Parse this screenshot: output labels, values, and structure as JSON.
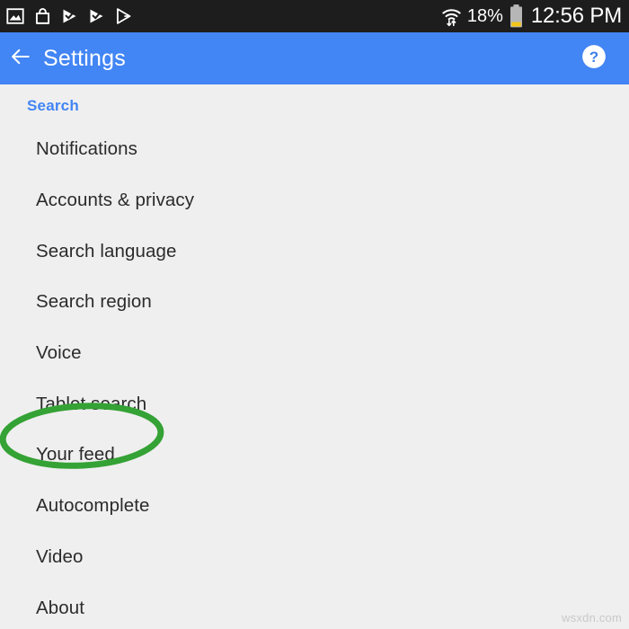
{
  "status_bar": {
    "background_color": "#1d1d1d",
    "left_icons": [
      {
        "name": "screenshot-icon",
        "label": "Screenshot"
      },
      {
        "name": "shopping-bag-icon",
        "label": "Shopping bag"
      },
      {
        "name": "play-check-icon-1",
        "label": "Play update"
      },
      {
        "name": "play-check-icon-2",
        "label": "Play update"
      },
      {
        "name": "play-store-icon",
        "label": "Play Store"
      }
    ],
    "wifi_icon": "wifi-transfer-icon",
    "battery_percent": "18%",
    "battery_icon": "battery-low-icon",
    "battery_fill_color": "#f5c518",
    "clock": "12:56 PM"
  },
  "app_bar": {
    "background_color": "#4285f4",
    "back_icon": "back-arrow-icon",
    "title": "Settings",
    "help_icon": "help-circle-icon"
  },
  "content": {
    "section_header": "Search",
    "section_header_color": "#4285f4",
    "background_color": "#efefef",
    "items": [
      {
        "label": "Notifications"
      },
      {
        "label": "Accounts & privacy"
      },
      {
        "label": "Search language"
      },
      {
        "label": "Search region"
      },
      {
        "label": "Voice"
      },
      {
        "label": "Tablet search"
      },
      {
        "label": "Your feed"
      },
      {
        "label": "Autocomplete"
      },
      {
        "label": "Video"
      },
      {
        "label": "About"
      }
    ]
  },
  "annotation": {
    "type": "ellipse-highlight",
    "target": "Voice",
    "color": "#34a234",
    "stroke_width": 7
  },
  "watermark": {
    "text": "wsxdn.com",
    "color": "#c9c9c9"
  }
}
